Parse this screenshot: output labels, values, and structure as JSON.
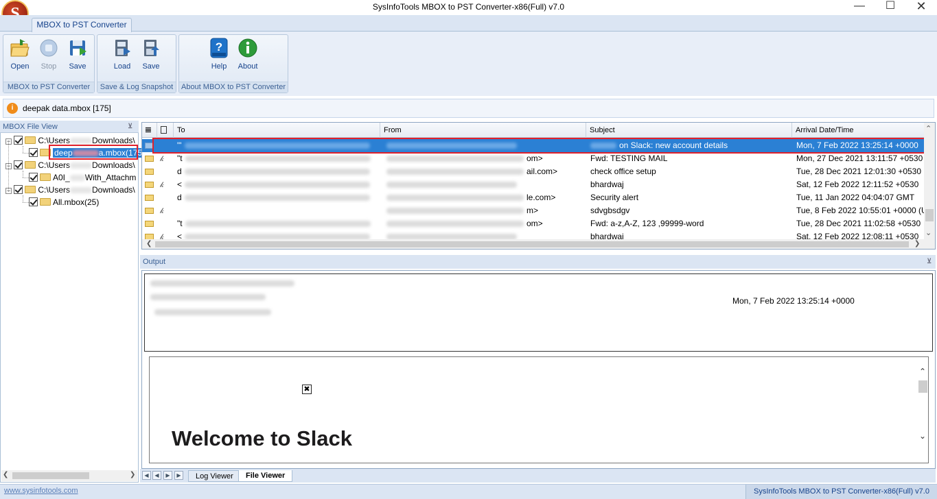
{
  "window": {
    "title": "SysInfoTools MBOX to PST Converter-x86(Full) v7.0",
    "controls": [
      "minimize",
      "maximize",
      "close"
    ]
  },
  "ribbon": {
    "tab": "MBOX to PST Converter",
    "groups": [
      {
        "label": "MBOX to PST Converter",
        "buttons": [
          {
            "label": "Open",
            "icon": "open-folder-icon",
            "enabled": true
          },
          {
            "label": "Stop",
            "icon": "stop-icon",
            "enabled": false
          },
          {
            "label": "Save",
            "icon": "save-icon",
            "enabled": true
          }
        ]
      },
      {
        "label": "Save & Log Snapshot",
        "buttons": [
          {
            "label": "Load",
            "icon": "load-snapshot-icon",
            "enabled": true
          },
          {
            "label": "Save",
            "icon": "save-snapshot-icon",
            "enabled": true
          }
        ]
      },
      {
        "label": "About MBOX to PST Converter",
        "buttons": [
          {
            "label": "Help",
            "icon": "help-icon",
            "enabled": true
          },
          {
            "label": "About",
            "icon": "info-icon",
            "enabled": true
          }
        ]
      }
    ]
  },
  "infobar": {
    "text": "deepak data.mbox [175]"
  },
  "file_view": {
    "header": "MBOX File View",
    "tree": [
      {
        "label": "C:\\Users",
        "suffix": "Downloads\\",
        "level": 0,
        "checked": true,
        "expander": "-"
      },
      {
        "label": "deep",
        "suffix": "a.mbox(175",
        "level": 1,
        "checked": true,
        "selected": true
      },
      {
        "label": "C:\\Users",
        "suffix": "Downloads\\",
        "level": 0,
        "checked": true,
        "expander": "-"
      },
      {
        "label": "A0I_",
        "suffix": "With_Attachm",
        "level": 1,
        "checked": true
      },
      {
        "label": "C:\\Users",
        "suffix": "Downloads\\",
        "level": 0,
        "checked": true,
        "expander": "-"
      },
      {
        "label": "All.mbox(25)",
        "suffix": "",
        "level": 1,
        "checked": true
      }
    ]
  },
  "grid": {
    "columns": [
      "To",
      "From",
      "Subject",
      "Arrival Date/Time"
    ],
    "rows": [
      {
        "to": "\"'",
        "from": "",
        "subject": "on Slack: new account details",
        "date": "Mon, 7 Feb 2022 13:25:14 +0000",
        "attach": false,
        "selected": true
      },
      {
        "to": "\"t",
        "from": "om>",
        "subject": "Fwd: TESTING MAIL",
        "date": "Mon, 27 Dec 2021 13:11:57 +0530",
        "attach": true,
        "selected": false
      },
      {
        "to": "d",
        "from": "ail.com>",
        "subject": "check office setup",
        "date": "Tue, 28 Dec 2021 12:01:30 +0530",
        "attach": false,
        "selected": false
      },
      {
        "to": "<",
        "from": "",
        "subject": "bhardwaj",
        "date": "Sat, 12 Feb 2022 12:11:52 +0530",
        "attach": true,
        "selected": false
      },
      {
        "to": "d",
        "from": "le.com>",
        "subject": "Security alert",
        "date": "Tue, 11 Jan 2022 04:04:07 GMT",
        "attach": false,
        "selected": false
      },
      {
        "to": "",
        "from": "m>",
        "subject": "sdvgbsdgv",
        "date": "Tue, 8 Feb 2022 10:55:01 +0000 (U...",
        "attach": true,
        "selected": false
      },
      {
        "to": "\"t",
        "from": "om>",
        "subject": "Fwd: a-z,A-Z, 123 ,99999-word",
        "date": "Tue, 28 Dec 2021 11:02:58 +0530",
        "attach": false,
        "selected": false
      },
      {
        "to": "<",
        "from": "",
        "subject": "bhardwaj",
        "date": "Sat, 12 Feb 2022 12:08:11 +0530",
        "attach": true,
        "selected": false
      }
    ]
  },
  "output": {
    "header": "Output",
    "date": "Mon, 7 Feb 2022 13:25:14 +0000",
    "body_heading": "Welcome to Slack"
  },
  "bottom_tabs": [
    "Log Viewer",
    "File Viewer"
  ],
  "status": {
    "link": "www.sysinfotools.com",
    "right": "SysInfoTools MBOX to PST Converter-x86(Full) v7.0"
  },
  "colors": {
    "selection": "#2b80d4",
    "highlight_box": "#e0202a",
    "ribbon_text": "#15428b"
  }
}
